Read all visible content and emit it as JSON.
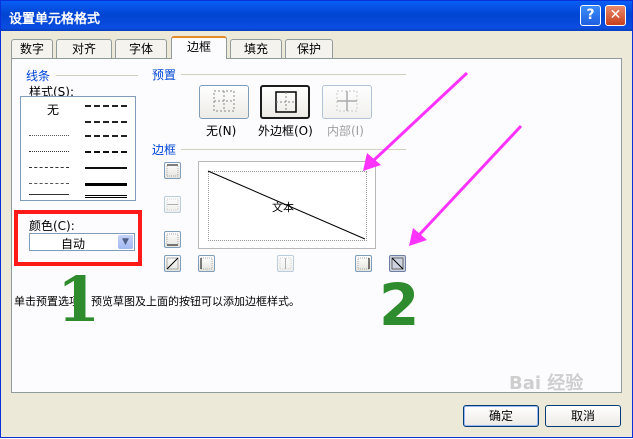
{
  "dialog": {
    "title": "设置单元格格式",
    "help_glyph": "?",
    "close_glyph": "✕"
  },
  "tabs": [
    "数字",
    "对齐",
    "字体",
    "边框",
    "填充",
    "保护"
  ],
  "active_tab": "边框",
  "line": {
    "group_label": "线条",
    "style_label": "样式(S):",
    "none_label": "无",
    "color_label": "颜色(C):",
    "color_value": "自动"
  },
  "presets": {
    "group_label": "预置",
    "items": [
      {
        "label": "无(N)",
        "state": "normal"
      },
      {
        "label": "外边框(O)",
        "state": "selected"
      },
      {
        "label": "内部(I)",
        "state": "disabled"
      }
    ]
  },
  "border": {
    "group_label": "边框",
    "preview_text": "文本"
  },
  "hint": "单击预置选项、预览草图及上面的按钮可以添加边框样式。",
  "buttons": {
    "ok": "确定",
    "cancel": "取消"
  },
  "annotations": {
    "label_1": "1",
    "label_2": "2",
    "highlight_color": "#ff1a1a",
    "arrow_color": "#ff33ff",
    "number_color": "#2e8b2e"
  },
  "watermark": "Bai 经验"
}
